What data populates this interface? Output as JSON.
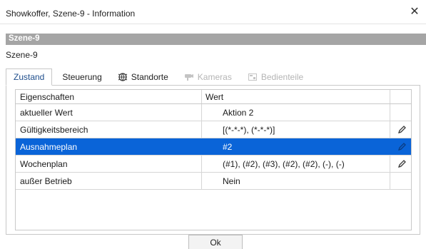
{
  "window": {
    "title": "Showkoffer, Szene-9 - Information",
    "close_glyph": "✕"
  },
  "header": {
    "title": "Szene-9"
  },
  "subtitle": "Szene-9",
  "tabs": [
    {
      "label": "Zustand",
      "active": true,
      "disabled": false
    },
    {
      "label": "Steuerung",
      "active": false,
      "disabled": false
    },
    {
      "label": "Standorte",
      "active": false,
      "disabled": false,
      "icon": "globe-icon"
    },
    {
      "label": "Kameras",
      "active": false,
      "disabled": true,
      "icon": "camera-icon"
    },
    {
      "label": "Bedienteile",
      "active": false,
      "disabled": true,
      "icon": "keypad-icon"
    }
  ],
  "table": {
    "columns": [
      "Eigenschaften",
      "Wert",
      ""
    ],
    "rows": [
      {
        "property": "aktueller Wert",
        "value": "Aktion 2",
        "editable": false,
        "selected": false
      },
      {
        "property": "Gültigkeitsbereich",
        "value": "[(*-*-*), (*-*-*)]",
        "editable": true,
        "selected": false
      },
      {
        "property": "Ausnahmeplan",
        "value": "#2",
        "editable": true,
        "selected": true
      },
      {
        "property": "Wochenplan",
        "value": "(#1), (#2), (#3), (#2), (#2), (-), (-)",
        "editable": true,
        "selected": false
      },
      {
        "property": "außer Betrieb",
        "value": "Nein",
        "editable": false,
        "selected": false
      }
    ]
  },
  "ok_label": "Ok",
  "colors": {
    "selection": "#0a64d8",
    "header_bar": "#a5a5a5",
    "active_tab_text": "#1f4e8c"
  }
}
